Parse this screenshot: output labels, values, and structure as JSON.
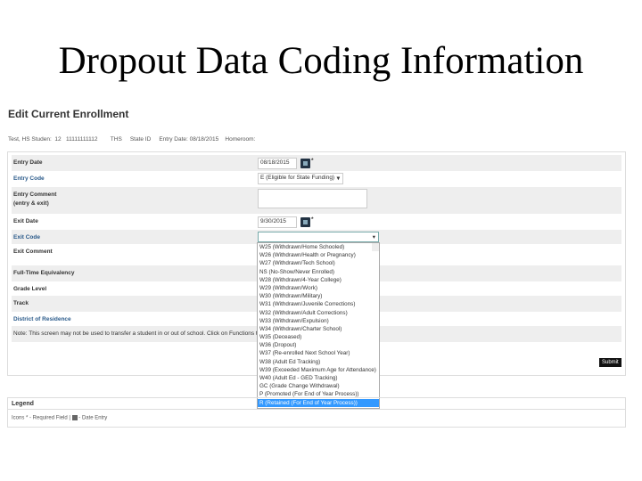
{
  "slide_title": "Dropout Data Coding Information",
  "heading": "Edit Current Enrollment",
  "student_info": "Test, HS Studen:  12   11111111112        THS     State ID     Entry Date: 08/18/2015    Homeroom:",
  "fields": {
    "entry_date_label": "Entry Date",
    "entry_date_value": "08/18/2015",
    "entry_code_label": "Entry Code",
    "entry_code_value": "E (Eligible for State Funding)",
    "entry_comment_label": "Entry Comment",
    "entry_comment_sub": "(entry & exit)",
    "exit_date_label": "Exit Date",
    "exit_date_value": "9/30/2015",
    "exit_code_label": "Exit Code",
    "exit_comment_label": "Exit Comment",
    "fte_label": "Full-Time Equivalency",
    "grade_label": "Grade Level",
    "track_label": "Track",
    "district_label": "District of Residence",
    "note": "Note: This screen may not be used to transfer a student in or out of school. Click on Functions to find link"
  },
  "required_mark": "*",
  "exit_code_options": [
    "W25 (Withdrawn/Home Schooled)",
    "W26 (Withdrawn/Health or Pregnancy)",
    "W27 (Withdrawn/Tech School)",
    "NS (No-Show/Never Enrolled)",
    "W28 (Withdrawn/4-Year College)",
    "W29 (Withdrawn/Work)",
    "W30 (Withdrawn/Military)",
    "W31 (Withdrawn/Juvenile Corrections)",
    "W32 (Withdrawn/Adult Corrections)",
    "W33 (Withdrawn/Expulsion)",
    "W34 (Withdrawn/Charter School)",
    "W35 (Deceased)",
    "W36 (Dropout)",
    "W37 (Re-enrolled Next School Year)",
    "W38 (Adult Ed Tracking)",
    "W39 (Exceeded Maximum Age for Attendance)",
    "W40 (Adult Ed - GED Tracking)",
    "GC (Grade Change Withdrawal)",
    "P (Promoted (For End of Year Process))",
    "R (Retained (For End of Year Process))"
  ],
  "selected_index": 19,
  "submit_label": "Submit",
  "legend": {
    "title": "Legend",
    "icons_label": "Icons",
    "required": "* - Required Field",
    "sep": "|",
    "date_entry": "- Date Entry"
  }
}
